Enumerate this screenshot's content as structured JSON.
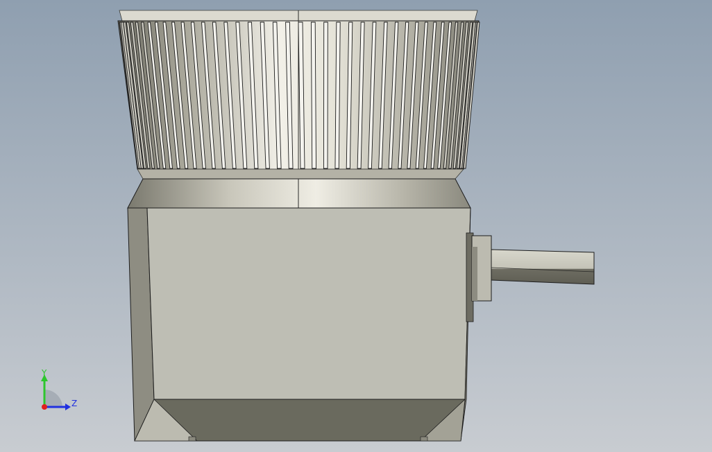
{
  "viewport": {
    "background": {
      "top": "#8f9fb0",
      "bottom": "#c8ccd1"
    }
  },
  "model": {
    "colors": {
      "metal_light": "#e8e6dc",
      "metal_mid": "#b9b7aa",
      "metal_dark": "#6f6e64",
      "body_face": "#bebeb4",
      "body_side": "#8e8d82",
      "hopper": "#6a6a5e",
      "outline": "#1c1c1c"
    }
  },
  "triad": {
    "y_label": "Y",
    "z_label": "Z",
    "colors": {
      "y": "#2ec62e",
      "z": "#2030e0",
      "x": "#e02020"
    }
  }
}
